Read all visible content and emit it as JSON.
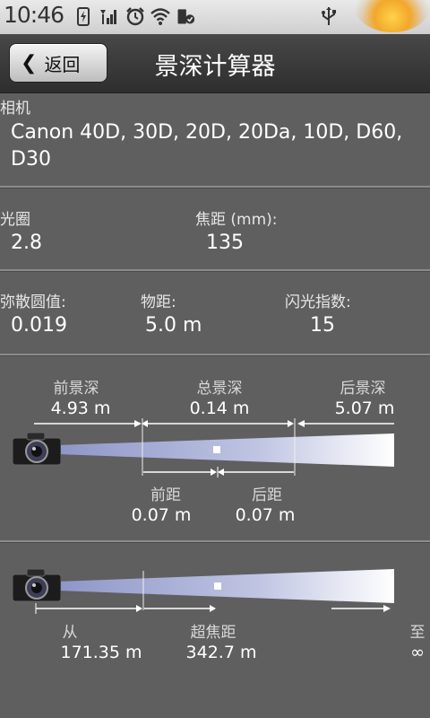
{
  "status_bar": {
    "time": "10:46"
  },
  "header": {
    "back_label": "返回",
    "title": "景深计算器"
  },
  "camera": {
    "label": "相机",
    "value_line1": "Canon 40D, 30D, 20D, 20Da, 10D, D60,",
    "value_line2": "D30"
  },
  "aperture": {
    "label": "光圈",
    "value": "2.8"
  },
  "focal_length": {
    "label": "焦距 (mm):",
    "value": "135"
  },
  "coc": {
    "label": "弥散圆值:",
    "value": "0.019"
  },
  "distance": {
    "label": "物距:",
    "value": "5.0 m"
  },
  "guide_number": {
    "label": "闪光指数:",
    "value": "15"
  },
  "dof_diagram": {
    "near_dof_label": "前景深",
    "near_dof_value": "4.93 m",
    "total_dof_label": "总景深",
    "total_dof_value": "0.14 m",
    "far_dof_label": "后景深",
    "far_dof_value": "5.07 m",
    "front_label": "前距",
    "front_value": "0.07 m",
    "back_label": "后距",
    "back_value": "0.07 m"
  },
  "hyperfocal_diagram": {
    "from_label": "从",
    "from_value": "171.35 m",
    "hyperfocal_label": "超焦距",
    "hyperfocal_value": "342.7 m",
    "to_label": "至",
    "to_value": "∞"
  }
}
